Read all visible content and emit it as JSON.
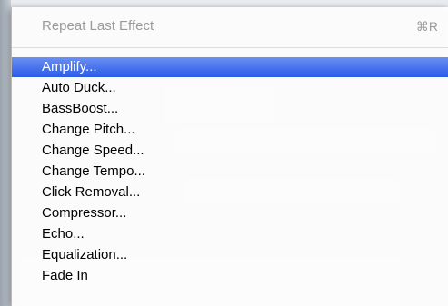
{
  "menu": {
    "header_item": {
      "label": "Repeat Last Effect",
      "shortcut": "⌘R"
    },
    "items": [
      {
        "label": "Amplify...",
        "highlighted": true
      },
      {
        "label": "Auto Duck..."
      },
      {
        "label": "BassBoost..."
      },
      {
        "label": "Change Pitch..."
      },
      {
        "label": "Change Speed..."
      },
      {
        "label": "Change Tempo..."
      },
      {
        "label": "Click Removal..."
      },
      {
        "label": "Compressor..."
      },
      {
        "label": "Echo..."
      },
      {
        "label": "Equalization..."
      },
      {
        "label": "Fade In"
      }
    ]
  },
  "colors": {
    "highlight": "#3b6ff0",
    "disabled_text": "#9a9a9a"
  }
}
